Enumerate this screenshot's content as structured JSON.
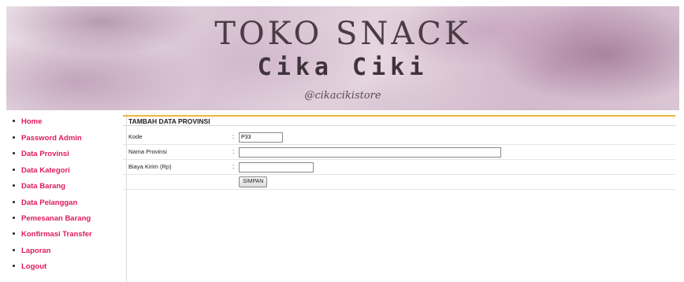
{
  "banner": {
    "title": "TOKO SNACK",
    "subtitle": "Cika Ciki",
    "handle": "@cikacikistore"
  },
  "sidebar": {
    "items": [
      {
        "label": "Home"
      },
      {
        "label": "Password Admin"
      },
      {
        "label": "Data Provinsi"
      },
      {
        "label": "Data Kategori"
      },
      {
        "label": "Data Barang"
      },
      {
        "label": "Data Pelanggan"
      },
      {
        "label": "Pemesanan Barang"
      },
      {
        "label": "Konfirmasi Transfer"
      },
      {
        "label": "Laporan"
      },
      {
        "label": "Logout"
      }
    ],
    "link_color": "#e0195b"
  },
  "form": {
    "header": "TAMBAH DATA PROVINSI",
    "separator": ":",
    "fields": {
      "kode": {
        "label": "Kode",
        "value": "P33"
      },
      "nama_provinsi": {
        "label": "Nama Provinsi",
        "value": ""
      },
      "biaya_kirim": {
        "label": "Biaya Kirim (Rp)",
        "value": ""
      }
    },
    "submit_label": "SIMPAN"
  },
  "colors": {
    "accent_rule": "#f0b43c"
  }
}
